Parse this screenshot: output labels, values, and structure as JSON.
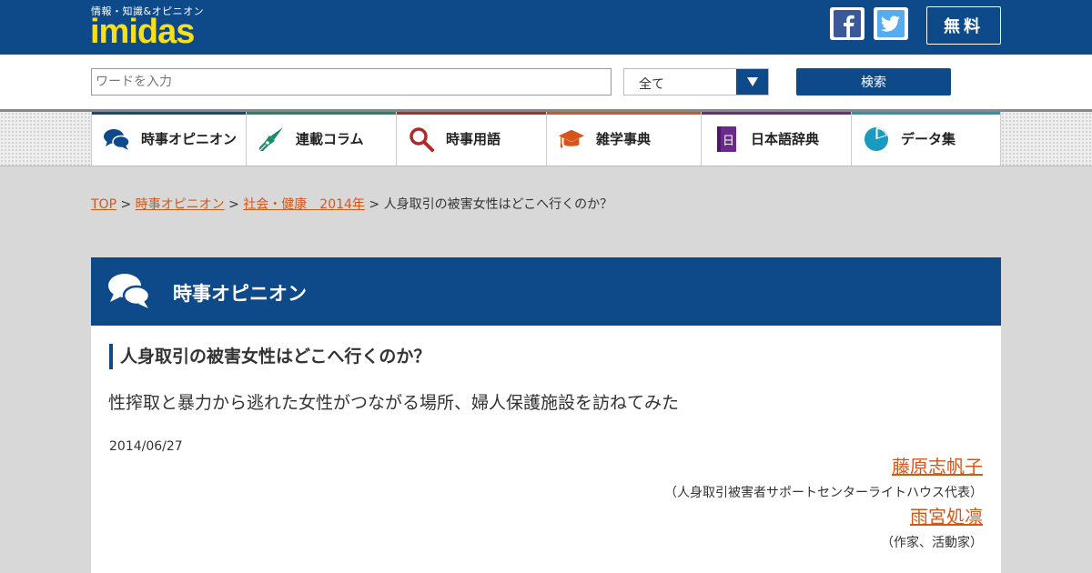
{
  "header": {
    "tagline": "情報・知識&オピニオン",
    "logo": "imidas",
    "free_label": "無料",
    "brand_color": "#0e4a8a",
    "logo_color": "#f7e01a"
  },
  "social": {
    "facebook_icon": "facebook-icon",
    "twitter_icon": "twitter-icon"
  },
  "search": {
    "placeholder": "ワードを入力",
    "value": "",
    "select_value": "全て",
    "button_label": "検索"
  },
  "nav": {
    "items": [
      {
        "label": "時事オピニオン",
        "icon": "speech-bubbles-icon",
        "color": "#0e4a8a"
      },
      {
        "label": "連載コラム",
        "icon": "fountain-pen-icon",
        "color": "#1a8a6a"
      },
      {
        "label": "時事用語",
        "icon": "magnifier-icon",
        "color": "#b02a2a"
      },
      {
        "label": "雑学事典",
        "icon": "graduation-cap-icon",
        "color": "#d6561a"
      },
      {
        "label": "日本語辞典",
        "icon": "book-icon",
        "color": "#6a2a8a"
      },
      {
        "label": "データ集",
        "icon": "pie-chart-icon",
        "color": "#1a9ac0"
      }
    ]
  },
  "breadcrumb": {
    "top": "TOP",
    "sep": " > ",
    "section": "時事オピニオン",
    "category": "社会・健康　2014年",
    "current": "人身取引の被害女性はどこへ行くのか？"
  },
  "article": {
    "section_title": "時事オピニオン",
    "title": "人身取引の被害女性はどこへ行くのか？",
    "subtitle": "性搾取と暴力から逃れた女性がつながる場所、婦人保護施設を訪ねてみた",
    "date": "2014/06/27",
    "authors": [
      {
        "name": "藤原志帆子",
        "affiliation": "（人身取引被害者サポートセンターライトハウス代表）"
      },
      {
        "name": "雨宮処凛",
        "affiliation": "（作家、活動家）"
      }
    ]
  }
}
